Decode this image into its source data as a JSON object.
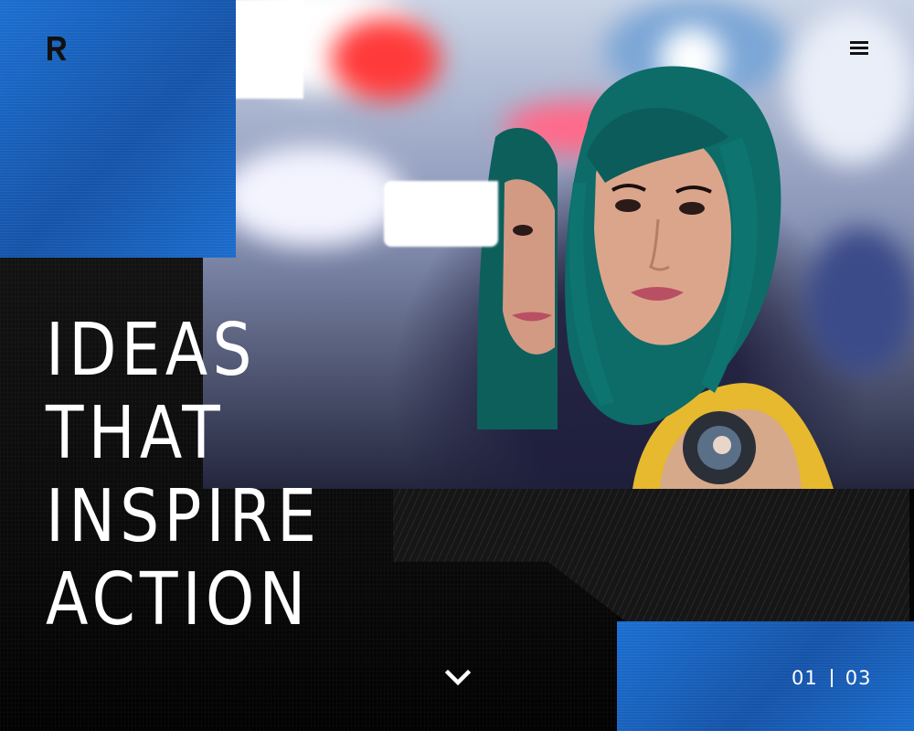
{
  "brand": {
    "logo_letter": "R",
    "accent_color": "#1b6fd1"
  },
  "header": {
    "menu_icon": "hamburger-menu-icon"
  },
  "hero": {
    "headline_lines": [
      "IDEAS",
      "THAT",
      "INSPIRE",
      "ACTION"
    ]
  },
  "controls": {
    "scroll_icon": "chevron-down-icon"
  },
  "pagination": {
    "current": "01",
    "total": "03"
  }
}
